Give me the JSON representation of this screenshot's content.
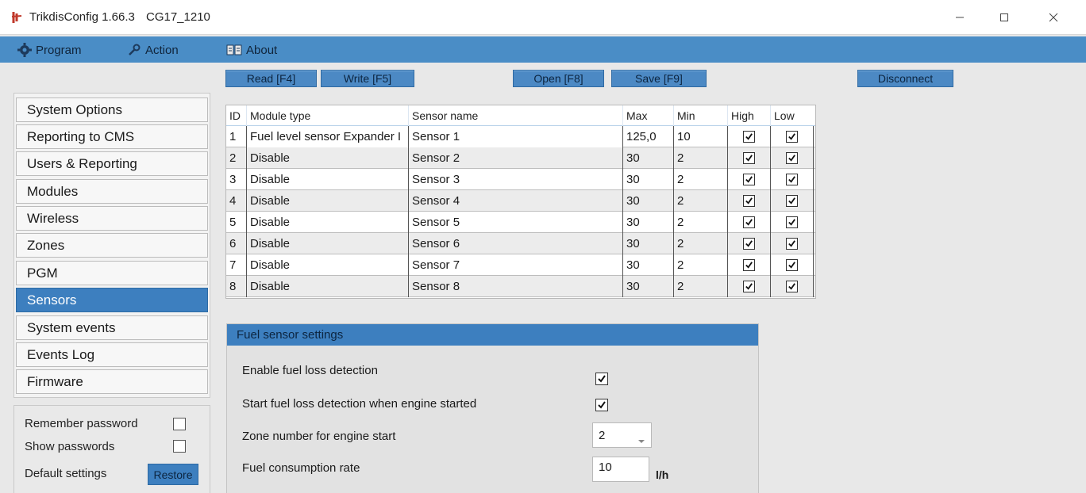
{
  "window": {
    "app_title": "TrikdisConfig 1.66.3",
    "file_name": "CG17_1210",
    "controls": {
      "minimize": "minimize-icon",
      "maximize": "maximize-icon",
      "close": "close-icon"
    }
  },
  "menu": {
    "program": "Program",
    "action": "Action",
    "about": "About"
  },
  "toolbar": {
    "read": "Read [F4]",
    "write": "Write [F5]",
    "open": "Open [F8]",
    "save": "Save [F9]",
    "disconnect": "Disconnect"
  },
  "sidebar": {
    "items": [
      {
        "label": "System Options"
      },
      {
        "label": "Reporting to CMS"
      },
      {
        "label": "Users & Reporting"
      },
      {
        "label": "Modules"
      },
      {
        "label": "Wireless"
      },
      {
        "label": "Zones"
      },
      {
        "label": "PGM"
      },
      {
        "label": "Sensors"
      },
      {
        "label": "System events"
      },
      {
        "label": "Events Log"
      },
      {
        "label": "Firmware"
      }
    ],
    "active": "Sensors",
    "options": {
      "remember_password": "Remember password",
      "show_passwords": "Show passwords",
      "default_settings": "Default settings",
      "restore": "Restore",
      "remember_password_checked": false,
      "show_passwords_checked": false
    }
  },
  "sensors_table": {
    "headers": {
      "id": "ID",
      "module_type": "Module type",
      "sensor_name": "Sensor name",
      "max": "Max",
      "min": "Min",
      "high": "High",
      "low": "Low"
    },
    "rows": [
      {
        "id": "1",
        "module_type": "Fuel level sensor Expander I",
        "sensor_name": "Sensor 1",
        "max": "125,0",
        "min": "10",
        "high": true,
        "low": true
      },
      {
        "id": "2",
        "module_type": "Disable",
        "sensor_name": "Sensor 2",
        "max": "30",
        "min": "2",
        "high": true,
        "low": true
      },
      {
        "id": "3",
        "module_type": "Disable",
        "sensor_name": "Sensor 3",
        "max": "30",
        "min": "2",
        "high": true,
        "low": true
      },
      {
        "id": "4",
        "module_type": "Disable",
        "sensor_name": "Sensor 4",
        "max": "30",
        "min": "2",
        "high": true,
        "low": true
      },
      {
        "id": "5",
        "module_type": "Disable",
        "sensor_name": "Sensor 5",
        "max": "30",
        "min": "2",
        "high": true,
        "low": true
      },
      {
        "id": "6",
        "module_type": "Disable",
        "sensor_name": "Sensor 6",
        "max": "30",
        "min": "2",
        "high": true,
        "low": true
      },
      {
        "id": "7",
        "module_type": "Disable",
        "sensor_name": "Sensor 7",
        "max": "30",
        "min": "2",
        "high": true,
        "low": true
      },
      {
        "id": "8",
        "module_type": "Disable",
        "sensor_name": "Sensor 8",
        "max": "30",
        "min": "2",
        "high": true,
        "low": true
      }
    ]
  },
  "fuel_settings": {
    "title": "Fuel sensor settings",
    "enable_loss_label": "Enable fuel loss detection",
    "enable_loss_checked": true,
    "start_on_engine_label": "Start fuel loss detection when engine started",
    "start_on_engine_checked": true,
    "zone_label": "Zone number for engine start",
    "zone_value": "2",
    "rate_label": "Fuel consumption rate",
    "rate_value": "10",
    "rate_unit": "l/h"
  },
  "colors": {
    "menubar": "#4a8dc6",
    "accent": "#3d7fbf",
    "button": "#4c89c4"
  }
}
